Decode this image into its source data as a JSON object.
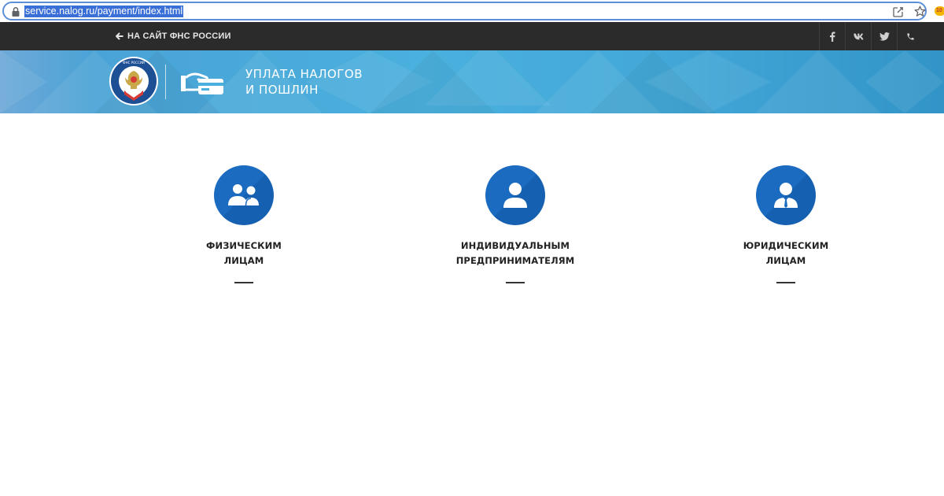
{
  "browser": {
    "url": "service.nalog.ru/payment/index.html",
    "ext_badge": "10"
  },
  "topbar": {
    "back_label": "НА САЙТ ФНС РОССИИ",
    "social": [
      "facebook-icon",
      "vk-icon",
      "twitter-icon",
      "phone-icon"
    ]
  },
  "banner": {
    "title_line1": "УПЛАТА НАЛОГОВ",
    "title_line2": "И ПОШЛИН"
  },
  "categories": [
    {
      "line1": "ФИЗИЧЕСКИМ",
      "line2": "ЛИЦАМ",
      "icon": "users-icon"
    },
    {
      "line1": "ИНДИВИДУАЛЬНЫМ",
      "line2": "ПРЕДПРИНИМАТЕЛЯМ",
      "icon": "user-icon"
    },
    {
      "line1": "ЮРИДИЧЕСКИМ",
      "line2": "ЛИЦАМ",
      "icon": "businessman-icon"
    }
  ],
  "colors": {
    "topbar_bg": "#2b2b2b",
    "banner_blue": "#4ab0dd",
    "circle_blue": "#1b6bc0"
  }
}
